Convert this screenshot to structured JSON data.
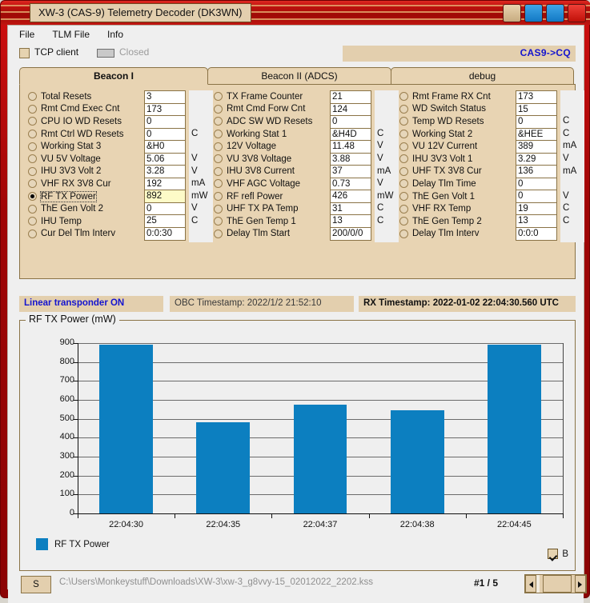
{
  "window": {
    "title": "XW-3 (CAS-9) Telemetry Decoder (DK3WN)",
    "buttons": [
      {
        "name": "titlebar-button-tan",
        "color": "#e8d3ae"
      },
      {
        "name": "titlebar-button-blue-1",
        "color": "#1279c4"
      },
      {
        "name": "titlebar-button-blue-2",
        "color": "#1279c4"
      },
      {
        "name": "titlebar-button-close",
        "color": "#c01008"
      }
    ]
  },
  "menu": {
    "items": [
      "File",
      "TLM File",
      "Info"
    ]
  },
  "connection": {
    "tcp_label": "TCP client",
    "tcp_checked": false,
    "status_label": "Closed",
    "callsign": "CAS9->CQ",
    "callsign_color": "#1414cf"
  },
  "tabs": [
    {
      "label": "Beacon I",
      "active": true
    },
    {
      "label": "Beacon II (ADCS)",
      "active": false
    },
    {
      "label": "debug",
      "active": false
    }
  ],
  "telemetry": {
    "col1": {
      "rows": [
        {
          "name": "Total Resets",
          "value": "3",
          "unit": "",
          "selected": false
        },
        {
          "name": "Rmt Cmd Exec Cnt",
          "value": "173",
          "unit": "",
          "selected": false
        },
        {
          "name": "CPU IO WD Resets",
          "value": "0",
          "unit": "",
          "selected": false
        },
        {
          "name": "Rmt Ctrl WD Resets",
          "value": "0",
          "unit": "C",
          "selected": false
        },
        {
          "name": "Working Stat 3",
          "value": "&H0",
          "unit": "",
          "selected": false
        },
        {
          "name": "VU 5V Voltage",
          "value": "5.06",
          "unit": "V",
          "selected": false
        },
        {
          "name": "IHU 3V3 Volt 2",
          "value": "3.28",
          "unit": "V",
          "selected": false
        },
        {
          "name": "VHF RX 3V8 Cur",
          "value": "192",
          "unit": "mA",
          "selected": false
        },
        {
          "name": "RF TX Power",
          "value": "892",
          "unit": "mW",
          "selected": true
        },
        {
          "name": "ThE Gen Volt 2",
          "value": "0",
          "unit": "V",
          "selected": false
        },
        {
          "name": "IHU Temp",
          "value": "25",
          "unit": "C",
          "selected": false
        },
        {
          "name": "Cur Del Tlm Interv",
          "value": "0:0:30",
          "unit": "",
          "selected": false
        }
      ]
    },
    "col2": {
      "rows": [
        {
          "name": "TX Frame Counter",
          "value": "21",
          "unit": "",
          "selected": false
        },
        {
          "name": "Rmt Cmd Forw Cnt",
          "value": "124",
          "unit": "",
          "selected": false
        },
        {
          "name": "ADC SW WD Resets",
          "value": "0",
          "unit": "",
          "selected": false
        },
        {
          "name": "Working Stat 1",
          "value": "&H4D",
          "unit": "C",
          "selected": false
        },
        {
          "name": "12V Voltage",
          "value": "11.48",
          "unit": "V",
          "selected": false
        },
        {
          "name": "VU 3V8 Voltage",
          "value": "3.88",
          "unit": "V",
          "selected": false
        },
        {
          "name": "IHU 3V8 Current",
          "value": "37",
          "unit": "mA",
          "selected": false
        },
        {
          "name": "VHF AGC Voltage",
          "value": "0.73",
          "unit": "V",
          "selected": false
        },
        {
          "name": "RF refl Power",
          "value": "426",
          "unit": "mW",
          "selected": false
        },
        {
          "name": "UHF TX PA Temp",
          "value": "31",
          "unit": "C",
          "selected": false
        },
        {
          "name": "ThE Gen Temp 1",
          "value": "13",
          "unit": "C",
          "selected": false
        },
        {
          "name": "Delay Tlm Start",
          "value": "200/0/0",
          "unit": "",
          "selected": false
        }
      ]
    },
    "col3": {
      "rows": [
        {
          "name": "Rmt Frame RX Cnt",
          "value": "173",
          "unit": "",
          "selected": false
        },
        {
          "name": "WD Switch Status",
          "value": "15",
          "unit": "",
          "selected": false
        },
        {
          "name": "Temp WD Resets",
          "value": "0",
          "unit": "C",
          "selected": false
        },
        {
          "name": "Working Stat 2",
          "value": "&HEE",
          "unit": "C",
          "selected": false
        },
        {
          "name": "VU 12V Current",
          "value": "389",
          "unit": "mA",
          "selected": false
        },
        {
          "name": "IHU 3V3 Volt 1",
          "value": "3.29",
          "unit": "V",
          "selected": false
        },
        {
          "name": "UHF TX 3V8 Cur",
          "value": "136",
          "unit": "mA",
          "selected": false
        },
        {
          "name": "Delay Tlm Time",
          "value": "0",
          "unit": "",
          "selected": false
        },
        {
          "name": "ThE Gen Volt 1",
          "value": "0",
          "unit": "V",
          "selected": false
        },
        {
          "name": "VHF RX Temp",
          "value": "19",
          "unit": "C",
          "selected": false
        },
        {
          "name": "ThE Gen Temp 2",
          "value": "13",
          "unit": "C",
          "selected": false
        },
        {
          "name": "Delay Tlm Interv",
          "value": "0:0:0",
          "unit": "",
          "selected": false
        }
      ]
    }
  },
  "status": {
    "transponder": "Linear transponder ON",
    "obc_timestamp": "OBC Timestamp: 2022/1/2 21:52:10",
    "rx_timestamp": "RX Timestamp: 2022-01-02 22:04:30.560 UTC"
  },
  "chart_data": {
    "type": "bar",
    "title": "RF TX Power (mW)",
    "xlabel": "",
    "ylabel": "",
    "categories": [
      "22:04:30",
      "22:04:35",
      "22:04:37",
      "22:04:38",
      "22:04:45"
    ],
    "values": [
      892,
      483,
      573,
      543,
      892
    ],
    "series": [
      {
        "name": "RF TX Power",
        "values": [
          892,
          483,
          573,
          543,
          892
        ]
      }
    ],
    "ylim": [
      0,
      900
    ],
    "yticks": [
      0,
      100,
      200,
      300,
      400,
      500,
      600,
      700,
      800,
      900
    ],
    "grid": true,
    "legend": [
      {
        "label": "RF TX Power",
        "color": "#0c7fc0"
      }
    ],
    "legend_position": "bottom-left",
    "bar_color": "#0c7fc0"
  },
  "chart_controls": {
    "b_checkbox_label": "B",
    "b_checkbox_checked": true
  },
  "bottom": {
    "s_button": "S",
    "file_path": "C:\\Users\\Monkeystuff\\Downloads\\XW-3\\xw-3_g8vvy-15_02012022_2202.kss",
    "page_counter": "#1 / 5"
  }
}
